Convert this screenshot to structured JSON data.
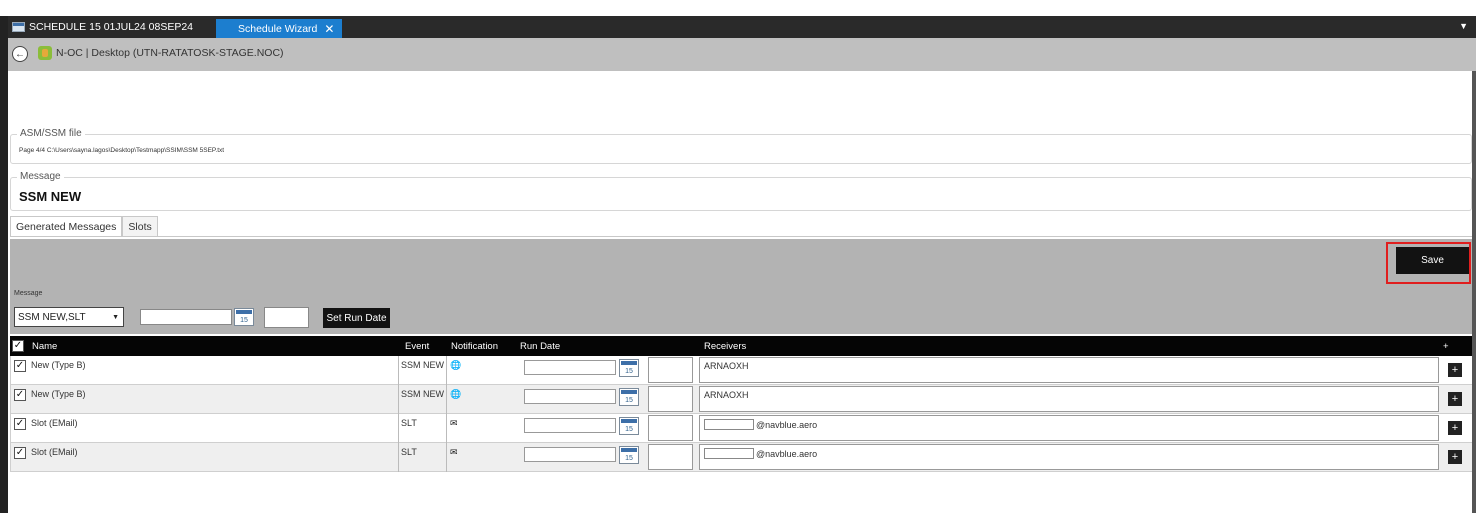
{
  "window": {
    "schedule_tab": "SCHEDULE 15  01JUL24 08SEP24",
    "wizard_tab": "Schedule Wizard",
    "close_glyph": "✕",
    "menu_glyph": "▼"
  },
  "nav": {
    "back_glyph": "←",
    "title": "N-OC | Desktop (UTN-RATATOSK-STAGE.NOC)"
  },
  "asm_file": {
    "legend": "ASM/SSM file",
    "value": "Page 4/4   C:\\Users\\sayna.lagos\\Desktop\\Testmapp\\SSIM\\SSM 5SEP.txt"
  },
  "message_group": {
    "legend": "Message",
    "value": "SSM  NEW"
  },
  "tabs": [
    "Generated Messages",
    "Slots"
  ],
  "panel": {
    "save_label": "Save",
    "message_label": "Message",
    "message_select": "SSM NEW,SLT",
    "calendar_day": "15",
    "set_run_label": "Set Run Date"
  },
  "table": {
    "headers": {
      "name": "Name",
      "event": "Event",
      "notification": "Notification",
      "run_date": "Run Date",
      "receivers": "Receivers",
      "add": "+"
    },
    "rows": [
      {
        "name": "New (Type B)",
        "event": "SSM NEW",
        "notification_icon": "globe-icon",
        "receivers": "ARNAOXH",
        "checked": true
      },
      {
        "name": "New (Type B)",
        "event": "SSM NEW",
        "notification_icon": "globe-icon",
        "receivers": "ARNAOXH",
        "checked": true
      },
      {
        "name": "Slot (EMail)",
        "event": "SLT",
        "notification_icon": "mail-icon",
        "receivers": "@navblue.aero",
        "checked": true
      },
      {
        "name": "Slot (EMail)",
        "event": "SLT",
        "notification_icon": "mail-icon",
        "receivers": "@navblue.aero",
        "checked": true
      }
    ]
  },
  "colors": {
    "accent": "#1c7ecf",
    "highlight": "#e01e1e",
    "header_bg": "#050505",
    "panel_bg": "#b3b3b3"
  }
}
